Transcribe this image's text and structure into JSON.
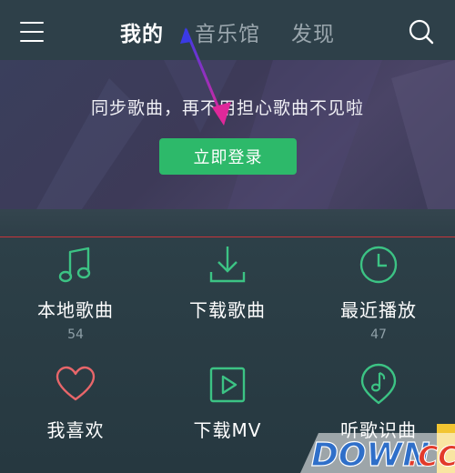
{
  "header": {
    "tabs": [
      {
        "label": "我的",
        "active": true
      },
      {
        "label": "音乐馆",
        "active": false
      },
      {
        "label": "发现",
        "active": false
      }
    ],
    "menu_icon": "hamburger-menu-icon",
    "search_icon": "search-icon"
  },
  "banner": {
    "message": "同步歌曲，再不用担心歌曲不见啦",
    "login_label": "立即登录"
  },
  "grid": {
    "items": [
      {
        "label": "本地歌曲",
        "count": "54",
        "icon": "music-note-icon"
      },
      {
        "label": "下载歌曲",
        "count": "",
        "icon": "download-icon"
      },
      {
        "label": "最近播放",
        "count": "47",
        "icon": "clock-icon"
      },
      {
        "label": "我喜欢",
        "count": "",
        "icon": "heart-icon"
      },
      {
        "label": "下载MV",
        "count": "",
        "icon": "play-video-icon"
      },
      {
        "label": "听歌识曲",
        "count": "",
        "icon": "music-recognition-icon"
      }
    ]
  },
  "watermark": {
    "text": "DOWN.CC"
  },
  "colors": {
    "accent_green": "#2db96a",
    "icon_green": "#3cc384",
    "heart_red": "#e8666a",
    "divider_red": "#c8343a",
    "arrow_blue": "#3a3ae6",
    "arrow_magenta": "#e0289a"
  }
}
